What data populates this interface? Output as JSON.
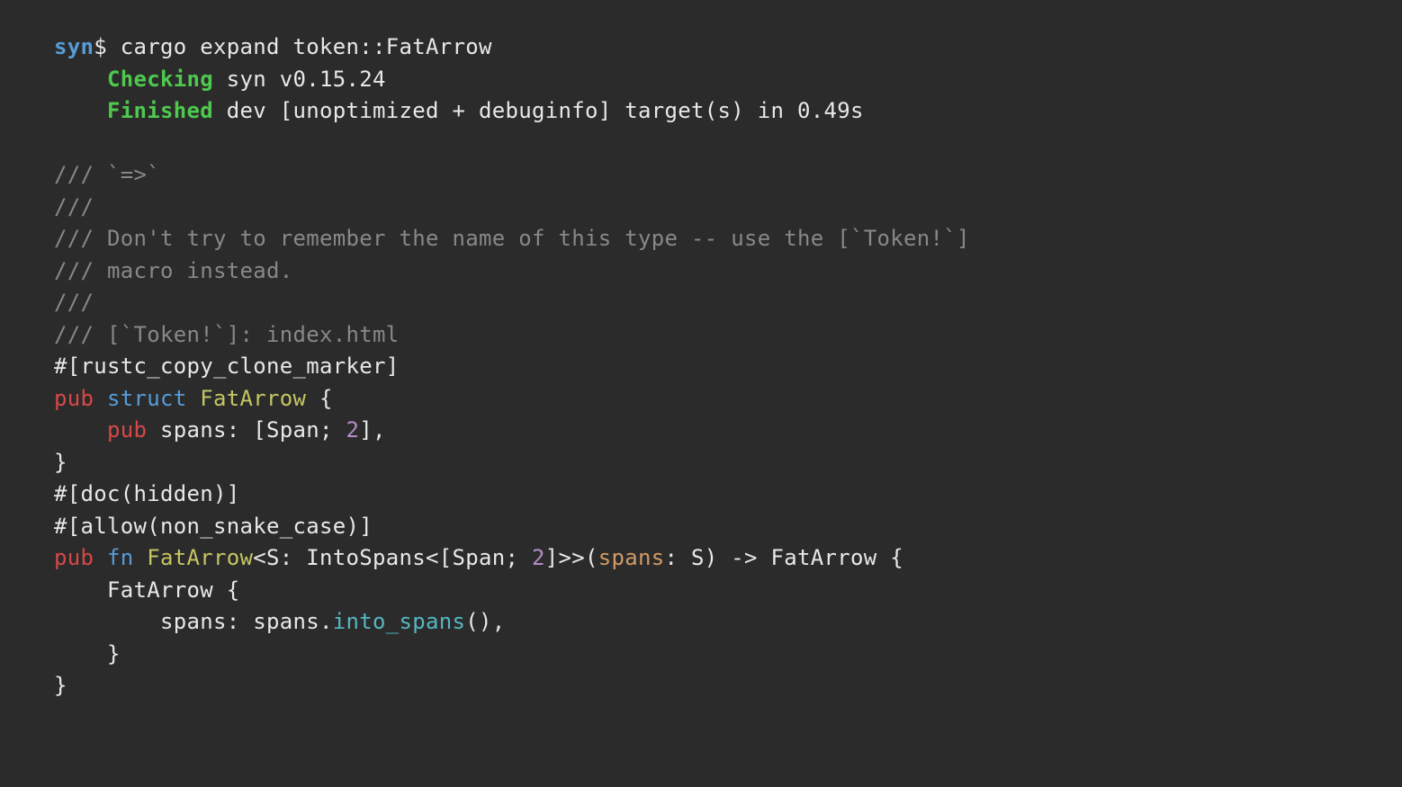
{
  "prompt": {
    "cwd": "syn",
    "dollar": "$ ",
    "command": "cargo expand token::FatArrow"
  },
  "cargo_output": {
    "checking_label": "Checking",
    "checking_text": " syn v0.15.24",
    "finished_label": "Finished",
    "finished_text": " dev [unoptimized + debuginfo] target(s) in 0.49s"
  },
  "blank_line": "",
  "doc_comments": {
    "line1": "/// `=>`",
    "line2": "///",
    "line3": "/// Don't try to remember the name of this type -- use the [`Token!`]",
    "line4": "/// macro instead.",
    "line5": "///",
    "line6": "/// [`Token!`]: index.html"
  },
  "attr1": "#[rustc_copy_clone_marker]",
  "struct_def": {
    "pub": "pub",
    "sp1": " ",
    "struct_kw": "struct",
    "sp2": " ",
    "name": "FatArrow",
    "sp3": " ",
    "brace_open": "{",
    "indent": "    ",
    "field_pub": "pub",
    "field_rest": " spans: [Span; ",
    "field_num": "2",
    "field_end": "],",
    "brace_close": "}"
  },
  "attr2": "#[doc(hidden)]",
  "attr3": "#[allow(non_snake_case)]",
  "fn_def": {
    "pub": "pub",
    "sp1": " ",
    "fn_kw": "fn",
    "sp2": " ",
    "name": "FatArrow",
    "generics1": "<S: IntoSpans<[Span; ",
    "num": "2",
    "generics2": "]>>(",
    "param": "spans",
    "rest1": ": S) -> FatArrow {",
    "body_indent1": "    ",
    "body_line1": "FatArrow {",
    "body_indent2": "        ",
    "body_line2_a": "spans: spans.",
    "body_line2_method": "into_spans",
    "body_line2_b": "(),",
    "body_indent3": "    ",
    "body_line3": "}",
    "brace_close": "}"
  }
}
